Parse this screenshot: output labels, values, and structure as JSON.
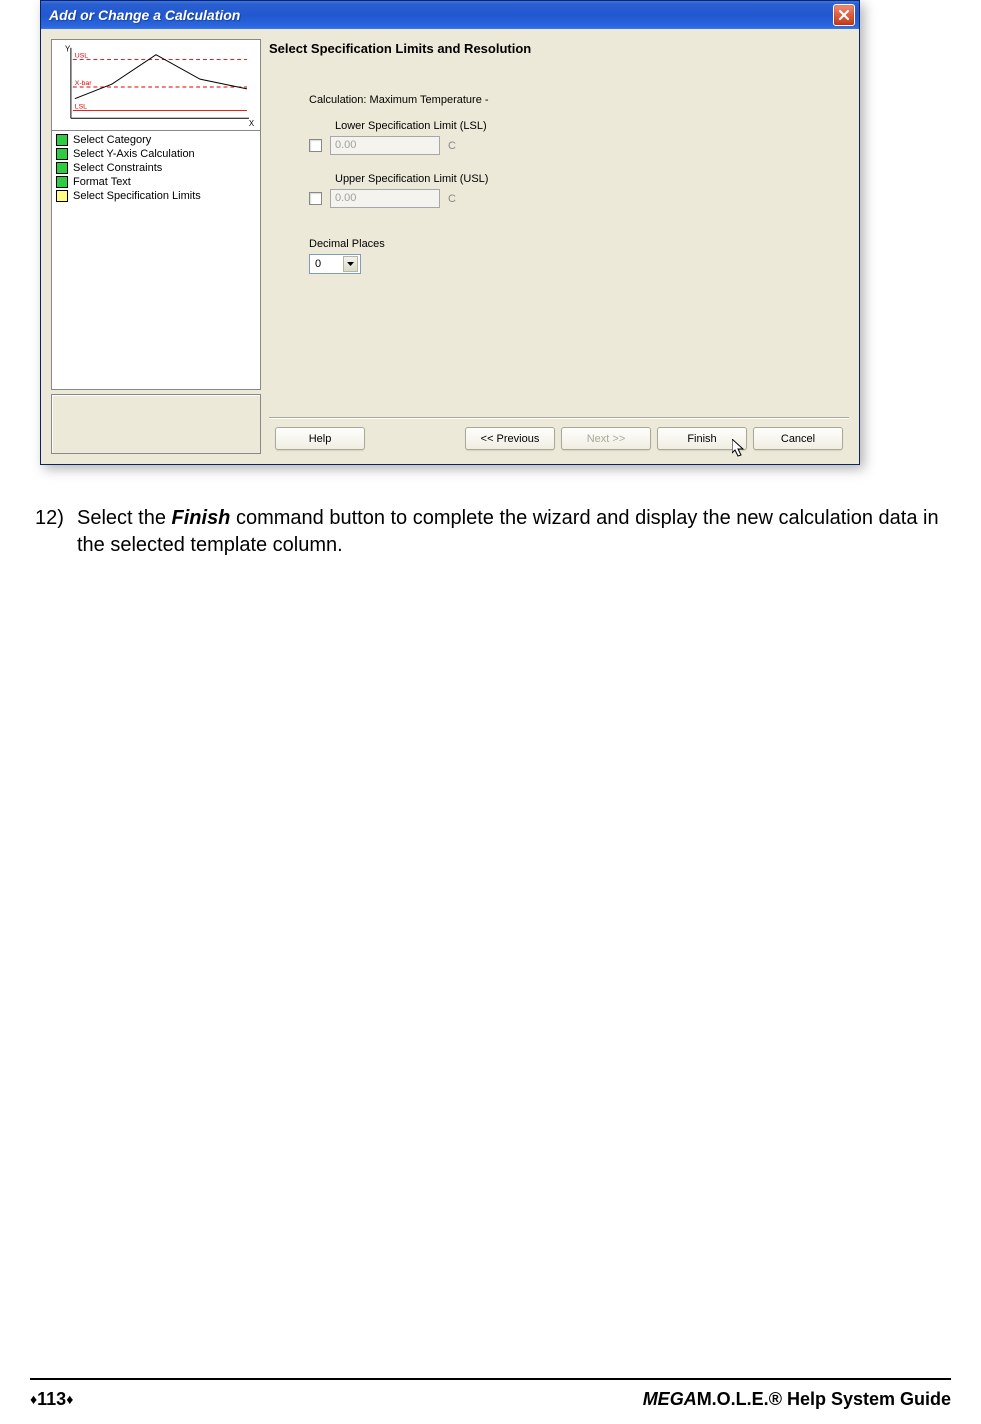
{
  "dialog": {
    "title": "Add or Change a Calculation",
    "graph": {
      "y_label": "Y",
      "usl_label": "USL",
      "xbar_label": "X-bar",
      "lsl_label": "LSL",
      "x_label": "X"
    },
    "steps": [
      {
        "label": "Select Category",
        "color": "green"
      },
      {
        "label": "Select Y-Axis Calculation",
        "color": "green"
      },
      {
        "label": "Select Constraints",
        "color": "green"
      },
      {
        "label": "Format Text",
        "color": "green"
      },
      {
        "label": "Select Specification Limits",
        "color": "yellow"
      }
    ],
    "panel": {
      "heading": "Select Specification Limits and Resolution",
      "calculation_label": "Calculation: Maximum Temperature -",
      "lsl_label": "Lower Specification Limit (LSL)",
      "lsl_value": "0.00",
      "lsl_unit": "C",
      "usl_label": "Upper Specification Limit (USL)",
      "usl_value": "0.00",
      "usl_unit": "C",
      "decimal_label": "Decimal Places",
      "decimal_value": "0"
    },
    "buttons": {
      "help": "Help",
      "previous": "<< Previous",
      "next": "Next >>",
      "finish": "Finish",
      "cancel": "Cancel"
    }
  },
  "instruction": {
    "number": "12)",
    "pre": "Select the ",
    "bold": "Finish",
    "post": " command button to complete the wizard and display the new calculation data in the selected template column."
  },
  "footer": {
    "page": "113",
    "brand_italic": "MEGA",
    "brand_rest": "M.O.L.E.® Help System Guide"
  }
}
